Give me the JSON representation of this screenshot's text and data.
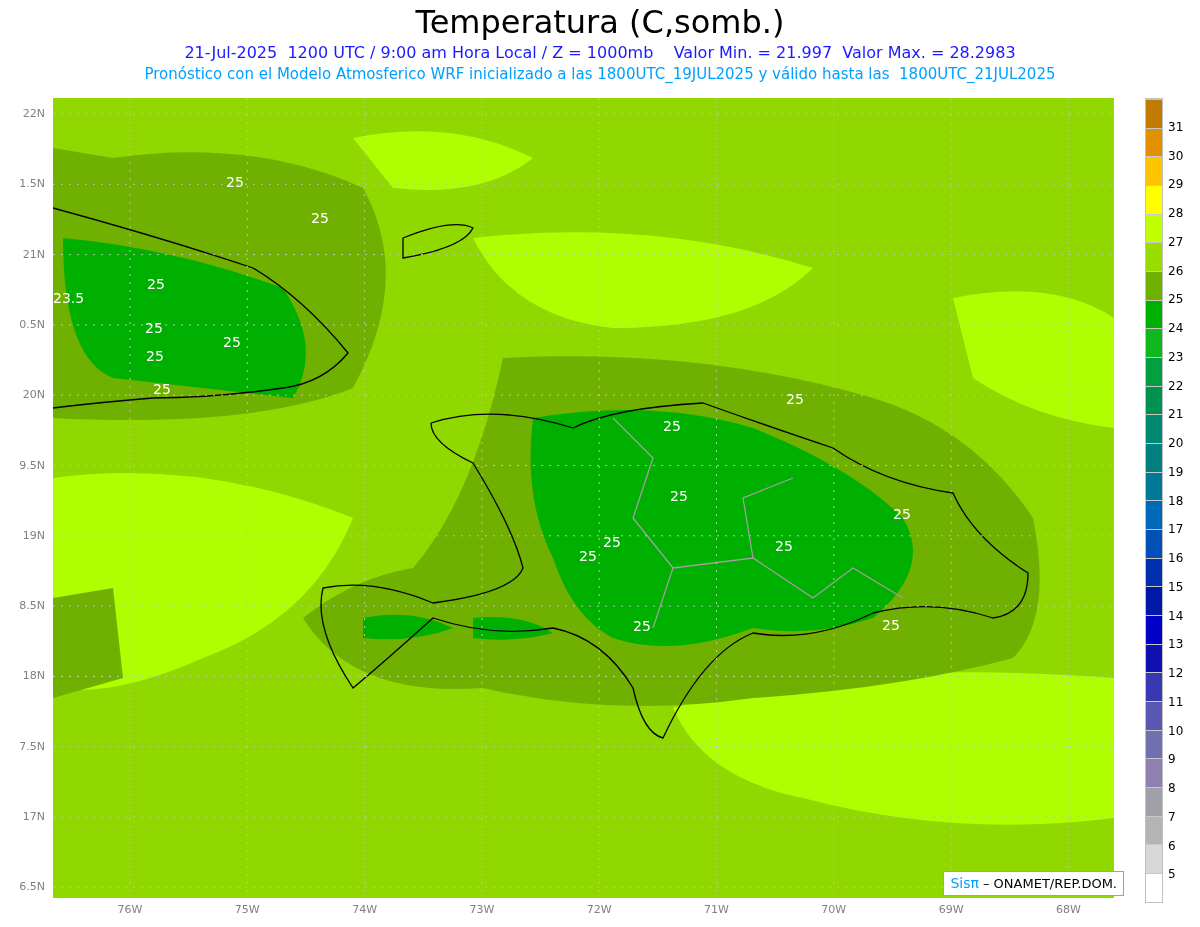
{
  "title": "Temperatura (C,somb.)",
  "subtitle": "21-Jul-2025  1200 UTC / 9:00 am Hora Local / Z = 1000mb    Valor Min. = 21.997  Valor Max. = 28.2983",
  "model_line": "Pronóstico con el Modelo Atmosferico WRF inicializado a las 1800UTC_19JUL2025 y válido hasta las  1800UTC_21JUL2025",
  "map": {
    "y_ticks": [
      "22N",
      "1.5N",
      "21N",
      "0.5N",
      "20N",
      "9.5N",
      "19N",
      "8.5N",
      "18N",
      "7.5N",
      "17N",
      "6.5N"
    ],
    "x_ticks": [
      "76W",
      "75W",
      "74W",
      "73W",
      "72W",
      "71W",
      "70W",
      "69W",
      "68W"
    ],
    "contour_labels": [
      "25",
      "25",
      "25",
      "23.5",
      "25",
      "25",
      "25",
      "25",
      "25",
      "25",
      "25",
      "25",
      "25",
      "25",
      "25",
      "25",
      "25"
    ]
  },
  "legend": {
    "labels": [
      "31",
      "30",
      "29",
      "28",
      "27",
      "26",
      "25",
      "24",
      "23",
      "22",
      "21",
      "20",
      "19",
      "18",
      "17",
      "16",
      "15",
      "14",
      "13",
      "12",
      "11",
      "10",
      "9",
      "8",
      "7",
      "6",
      "5"
    ],
    "swatches": [
      {
        "color": "#c07c00"
      },
      {
        "color": "#e09000"
      },
      {
        "color": "#ffc400"
      },
      {
        "color": "#ffff00"
      },
      {
        "color": "#c0ff00"
      },
      {
        "color": "#98dc00"
      },
      {
        "color": "#70b000"
      },
      {
        "color": "#00b000"
      },
      {
        "color": "#10b820"
      },
      {
        "color": "#00a040"
      },
      {
        "color": "#009050"
      },
      {
        "color": "#008870"
      },
      {
        "color": "#008080"
      },
      {
        "color": "#007898"
      },
      {
        "color": "#0068b8"
      },
      {
        "color": "#0050b8"
      },
      {
        "color": "#0030b0"
      },
      {
        "color": "#0018a8"
      },
      {
        "color": "#0000c8"
      },
      {
        "color": "#1010b0"
      },
      {
        "color": "#3838b0"
      },
      {
        "color": "#5858b0"
      },
      {
        "color": "#7070b0"
      },
      {
        "color": "#9080b0"
      },
      {
        "color": "#a0a0a8"
      },
      {
        "color": "#b4b4b4"
      },
      {
        "color": "#d8d8d8"
      },
      {
        "color": "#ffffff"
      }
    ]
  },
  "credit": {
    "brand": "Sisπ",
    "text": "– ONAMET/REP.DOM."
  }
}
